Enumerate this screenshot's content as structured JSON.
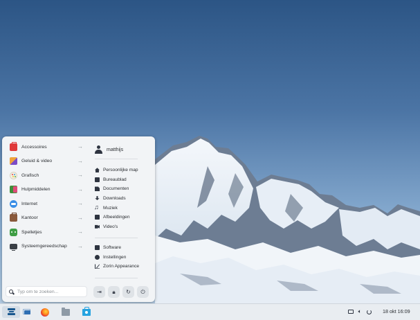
{
  "menu": {
    "categories": [
      {
        "label": "Accessoires",
        "icon": "toolbox-icon"
      },
      {
        "label": "Geluid & video",
        "icon": "media-icon"
      },
      {
        "label": "Grafisch",
        "icon": "palette-icon"
      },
      {
        "label": "Hulpmiddelen",
        "icon": "help-icon"
      },
      {
        "label": "Internet",
        "icon": "cloud-icon"
      },
      {
        "label": "Kantoor",
        "icon": "briefcase-icon"
      },
      {
        "label": "Spelletjes",
        "icon": "gamepad-icon"
      },
      {
        "label": "Systeemgereedschap",
        "icon": "monitor-icon"
      }
    ],
    "user": {
      "name": "matthijs",
      "icon": "user-icon"
    },
    "places": [
      {
        "label": "Persoonlijke map",
        "icon": "home-icon"
      },
      {
        "label": "Bureaublad",
        "icon": "desktop-icon"
      },
      {
        "label": "Documenten",
        "icon": "document-icon"
      },
      {
        "label": "Downloads",
        "icon": "download-icon"
      },
      {
        "label": "Muziek",
        "icon": "music-icon"
      },
      {
        "label": "Afbeeldingen",
        "icon": "image-icon"
      },
      {
        "label": "Video's",
        "icon": "video-icon"
      }
    ],
    "system": [
      {
        "label": "Software",
        "icon": "software-icon"
      },
      {
        "label": "Instellingen",
        "icon": "settings-icon"
      },
      {
        "label": "Zorin Appearance",
        "icon": "zorin-appearance-icon"
      }
    ],
    "search": {
      "placeholder": "Typ om te zoeken...",
      "value": ""
    },
    "power_buttons": [
      {
        "name": "logout-button",
        "icon": "logout-icon"
      },
      {
        "name": "lock-button",
        "icon": "lock-icon"
      },
      {
        "name": "restart-button",
        "icon": "restart-icon"
      },
      {
        "name": "shutdown-button",
        "icon": "power-icon"
      }
    ]
  },
  "taskbar": {
    "apps": [
      {
        "name": "zorin-menu-button",
        "icon": "zorin-logo-icon"
      },
      {
        "name": "window-switcher-button",
        "icon": "windows-icon"
      },
      {
        "name": "firefox-button",
        "icon": "firefox-icon"
      },
      {
        "name": "files-button",
        "icon": "folder-icon"
      },
      {
        "name": "software-store-button",
        "icon": "store-icon"
      }
    ],
    "tray": {
      "icons": [
        "screen-icon",
        "volume-icon",
        "power-icon"
      ]
    },
    "clock": "18 okt  16:09"
  },
  "colors": {
    "sky_top": "#2c5585",
    "sky_bottom": "#a9c4de",
    "menu_bg": "#f2f4f6",
    "taskbar_bg": "#e9edf1"
  }
}
